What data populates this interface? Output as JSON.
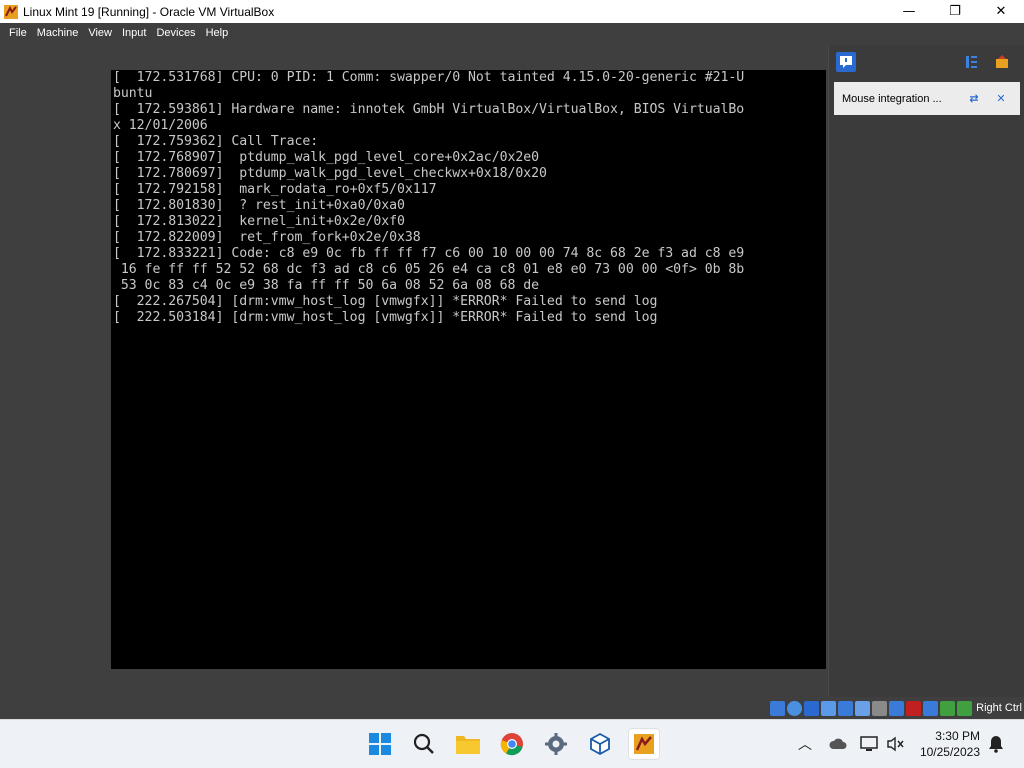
{
  "window": {
    "title": "Linux Mint 19 [Running] - Oracle VM VirtualBox",
    "minimize_glyph": "—",
    "maximize_glyph": "❐",
    "close_glyph": "✕"
  },
  "menu": {
    "items": [
      "File",
      "Machine",
      "View",
      "Input",
      "Devices",
      "Help"
    ]
  },
  "console": {
    "lines": [
      "[  172.531768] CPU: 0 PID: 1 Comm: swapper/0 Not tainted 4.15.0-20-generic #21-U",
      "buntu",
      "[  172.593861] Hardware name: innotek GmbH VirtualBox/VirtualBox, BIOS VirtualBo",
      "x 12/01/2006",
      "[  172.759362] Call Trace:",
      "[  172.768907]  ptdump_walk_pgd_level_core+0x2ac/0x2e0",
      "[  172.780697]  ptdump_walk_pgd_level_checkwx+0x18/0x20",
      "[  172.792158]  mark_rodata_ro+0xf5/0x117",
      "[  172.801830]  ? rest_init+0xa0/0xa0",
      "[  172.813022]  kernel_init+0x2e/0xf0",
      "[  172.822009]  ret_from_fork+0x2e/0x38",
      "[  172.833221] Code: c8 e9 0c fb ff ff f7 c6 00 10 00 00 74 8c 68 2e f3 ad c8 e9",
      " 16 fe ff ff 52 52 68 dc f3 ad c8 c6 05 26 e4 ca c8 01 e8 e0 73 00 00 <0f> 0b 8b",
      " 53 0c 83 c4 0c e9 38 fa ff ff 50 6a 08 52 6a 08 68 de",
      "[  222.267504] [drm:vmw_host_log [vmwgfx]] *ERROR* Failed to send log",
      "[  222.503184] [drm:vmw_host_log [vmwgfx]] *ERROR* Failed to send log"
    ]
  },
  "notification": {
    "text": "Mouse integration ..."
  },
  "statusbar": {
    "host_key": "Right Ctrl"
  },
  "taskbar": {
    "time": "3:30 PM",
    "date": "10/25/2023"
  },
  "colors": {
    "accent": "#2a6ad0",
    "vm_bg": "#3f3f3f",
    "console_bg": "#000000",
    "console_fg": "#c8c8c8"
  }
}
